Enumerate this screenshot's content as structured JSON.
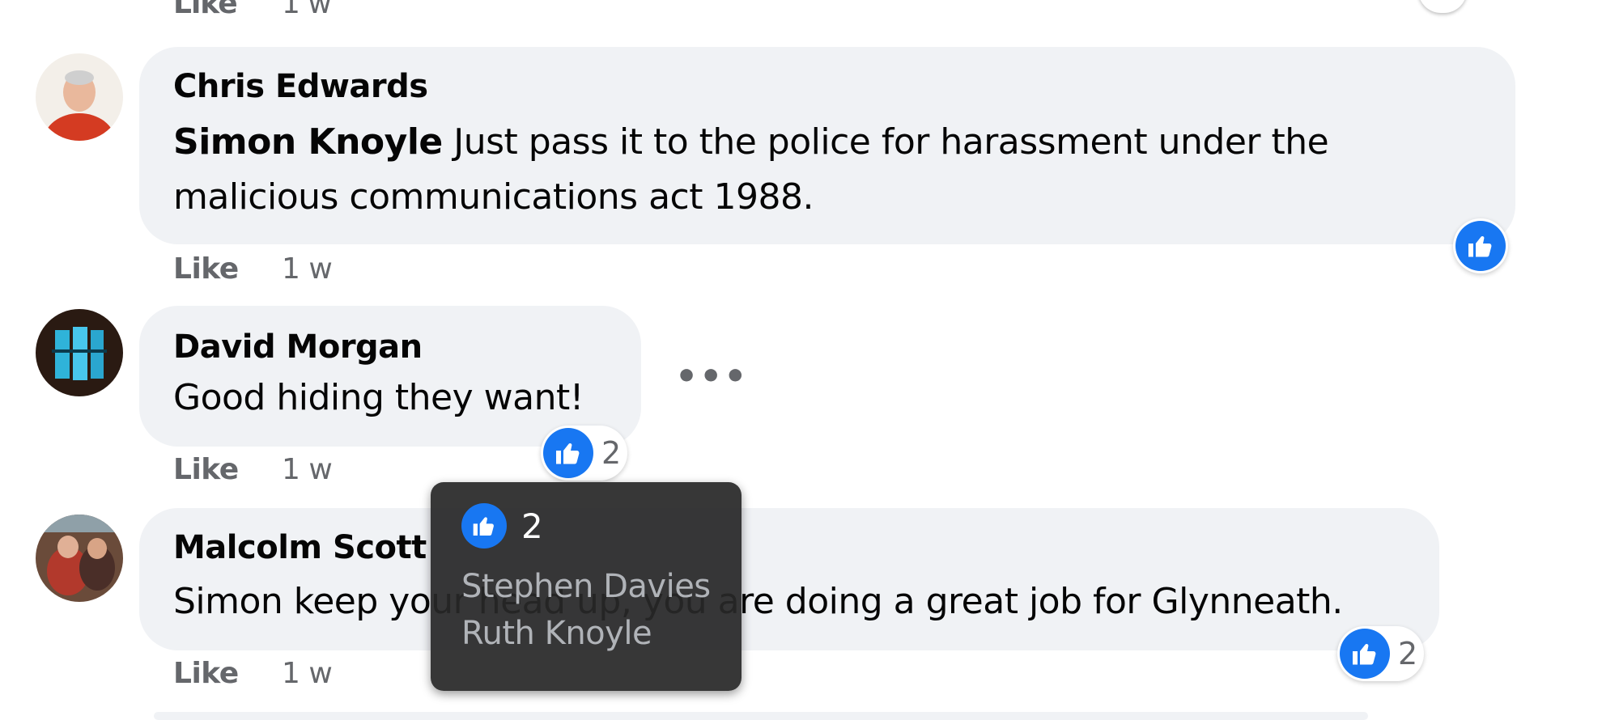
{
  "top": {
    "like_label": "Like",
    "time": "1 w"
  },
  "comments": [
    {
      "author": "Chris Edwards",
      "mention": "Simon Knoyle",
      "text_line1": " Just pass it to the police for harassment under the",
      "text_line2": "malicious communications act 1988.",
      "like_label": "Like",
      "time": "1 w",
      "reaction_icon": "thumbs-up-icon"
    },
    {
      "author": "David Morgan",
      "text_line1": "Good hiding they want!",
      "like_label": "Like",
      "time": "1 w",
      "reaction_icon": "thumbs-up-icon",
      "reaction_count": "2",
      "more_label": "•••"
    },
    {
      "author": "Malcolm Scott",
      "text_line1": "Simon keep your head up, you are doing a great job for Glynneath.",
      "like_label": "Like",
      "time": "1 w",
      "reaction_icon": "thumbs-up-icon",
      "reaction_count": "2"
    }
  ],
  "tooltip": {
    "count": "2",
    "names": [
      "Stephen Davies",
      "Ruth Knoyle"
    ]
  },
  "colors": {
    "bubble": "#f0f2f5",
    "like_blue": "#1877f2",
    "secondary_text": "#65676b",
    "tooltip_bg": "#282828"
  }
}
